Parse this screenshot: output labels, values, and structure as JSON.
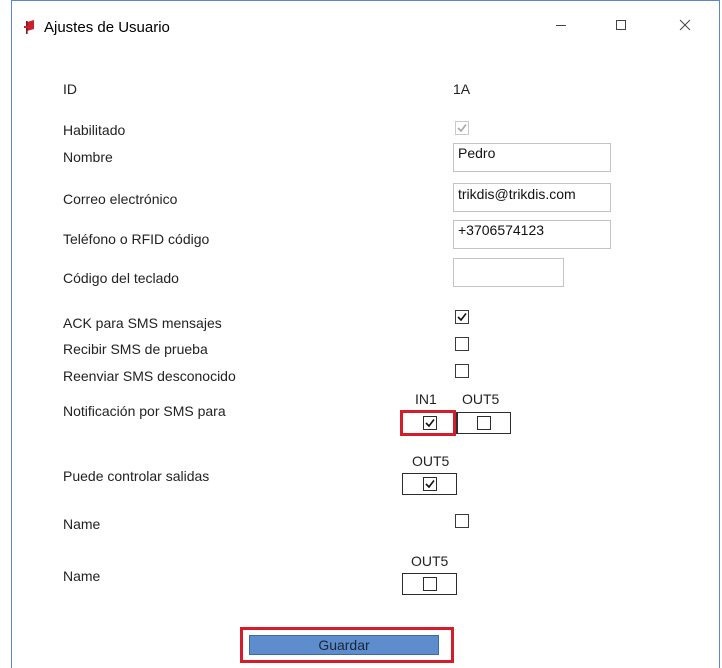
{
  "window": {
    "title": "Ajustes de Usuario",
    "minimize_label": "–",
    "maximize_label": "☐",
    "close_label": "✕"
  },
  "form": {
    "id": {
      "label": "ID",
      "value": "1A"
    },
    "enabled": {
      "label": "Habilitado",
      "checked": true,
      "disabled": true
    },
    "name": {
      "label": "Nombre",
      "value": "Pedro"
    },
    "email": {
      "label": "Correo electrónico",
      "value": "trikdis@trikdis.com"
    },
    "phone": {
      "label": "Teléfono o RFID código",
      "value": "+3706574123"
    },
    "keypad_code": {
      "label": "Código del teclado",
      "value": ""
    },
    "ack_sms": {
      "label": "ACK para SMS mensajes",
      "checked": true
    },
    "test_sms": {
      "label": "Recibir SMS de prueba",
      "checked": false
    },
    "forward_unknown_sms": {
      "label": "Reenviar SMS desconocido",
      "checked": false
    },
    "sms_notification": {
      "label": "Notificación por SMS para",
      "inputs": [
        {
          "name": "IN1",
          "checked": true
        },
        {
          "name": "OUT5",
          "checked": false
        }
      ]
    },
    "can_control_outputs": {
      "label": "Puede controlar salidas",
      "outputs": [
        {
          "name": "OUT5",
          "checked": true
        }
      ]
    },
    "name_flag_1": {
      "label": "Name",
      "checked": false
    },
    "name_flag_2": {
      "label": "Name",
      "outputs": [
        {
          "name": "OUT5",
          "checked": false
        }
      ]
    }
  },
  "actions": {
    "save_label": "Guardar"
  },
  "colors": {
    "highlight": "#d41c2a",
    "save_button": "#5d8dcc",
    "window_border": "#5a88c8"
  }
}
